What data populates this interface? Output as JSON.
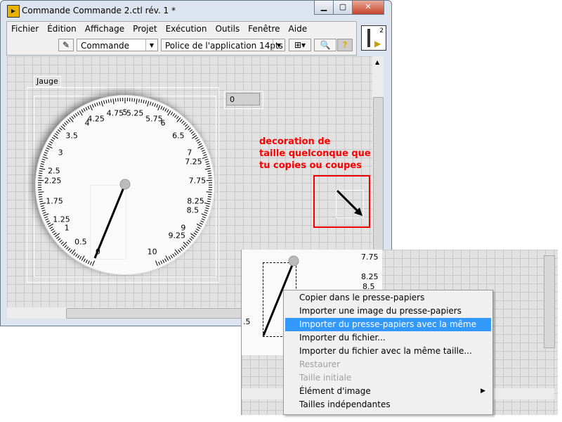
{
  "window": {
    "title": "Commande Commande 2.ctl rév. 1 *",
    "app_icon": "labview-icon",
    "controls": [
      "minimize",
      "maximize",
      "close"
    ]
  },
  "menubar": {
    "items": [
      "Fichier",
      "Édition",
      "Affichage",
      "Projet",
      "Exécution",
      "Outils",
      "Fenêtre",
      "Aide"
    ]
  },
  "toolbar": {
    "control_type": "Commande",
    "font": "Police de l'application 14pts"
  },
  "connector_pane": {
    "number": "2"
  },
  "gauge": {
    "label": "Jauge",
    "value": "0",
    "value_num": 0,
    "min": 0,
    "max": 10,
    "scale_labels": [
      "0",
      "0.5",
      "1",
      "1.25",
      "1.75",
      "2.25",
      "2.5",
      "3",
      "3.5",
      "4",
      "4.25",
      "4.75",
      "5",
      "5.25",
      "5.75",
      "6",
      "6.5",
      "7",
      "7.25",
      "7.75",
      "8.25",
      "8.5",
      "9",
      "9.25",
      "10"
    ]
  },
  "annotation": {
    "lines": [
      "decoration de",
      "taille quelconque que",
      "tu copies ou coupes"
    ],
    "color": "#ff0000"
  },
  "overlay_window": {
    "scale_labels": [
      "7.75",
      "8.25",
      "8.5",
      ".5"
    ]
  },
  "context_menu": {
    "items": [
      {
        "label": "Copier dans le presse-papiers",
        "state": "normal"
      },
      {
        "label": "Importer une image du presse-papiers",
        "state": "normal"
      },
      {
        "label": "Importer du presse-papiers avec la même taille",
        "state": "highlighted"
      },
      {
        "label": "Importer du fichier...",
        "state": "normal"
      },
      {
        "label": "Importer du fichier avec la même taille...",
        "state": "normal"
      },
      {
        "label": "Restaurer",
        "state": "disabled"
      },
      {
        "label": "Taille initiale",
        "state": "disabled"
      },
      {
        "label": "Élément d'image",
        "state": "submenu"
      },
      {
        "label": "Tailles indépendantes",
        "state": "normal"
      }
    ]
  }
}
